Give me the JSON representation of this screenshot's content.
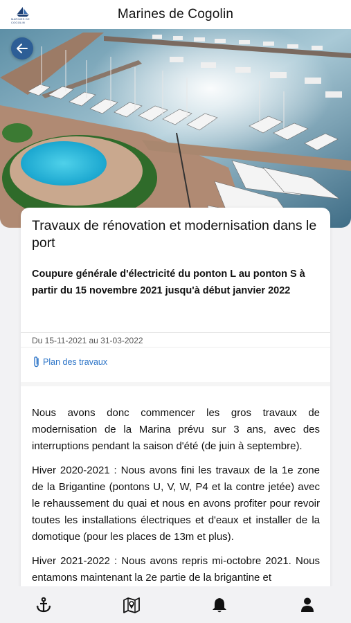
{
  "header": {
    "title": "Marines de Cogolin",
    "logo_text": "MARINES DE COGOLIN"
  },
  "hero": {
    "back_icon": "arrow-left-icon"
  },
  "article": {
    "title": "Travaux de rénovation et modernisation dans le port",
    "subtitle": "Coupure générale d'électricité du ponton L au ponton S à partir du 15 novembre 2021 jusqu'à début janvier 2022",
    "dates": "Du 15-11-2021 au 31-03-2022",
    "attachment": {
      "label": "Plan des travaux",
      "icon": "paperclip-icon"
    },
    "paragraphs": [
      "Nous avons donc commencer les gros travaux de modernisation de la Marina prévu sur 3 ans, avec des interruptions pendant la saison d'été (de juin à septembre).",
      "Hiver 2020-2021 : Nous avons fini les travaux de la 1e zone de la Brigantine (pontons U, V, W, P4 et la contre jetée) avec le rehaussement du quai et nous en avons profiter pour revoir toutes les installations électriques et d'eaux et installer de la domotique (pour les places de 13m et plus).",
      "Hiver 2021-2022 : Nous avons repris mi-octobre 2021. Nous entamons maintenant la 2e partie de la brigantine et"
    ]
  },
  "bottom_nav": {
    "items": [
      {
        "icon": "anchor-icon"
      },
      {
        "icon": "map-icon"
      },
      {
        "icon": "bell-icon"
      },
      {
        "icon": "user-icon"
      }
    ]
  },
  "colors": {
    "accent": "#2a73c7",
    "back_button": "#2d5e96",
    "background": "#f2f2f4"
  }
}
